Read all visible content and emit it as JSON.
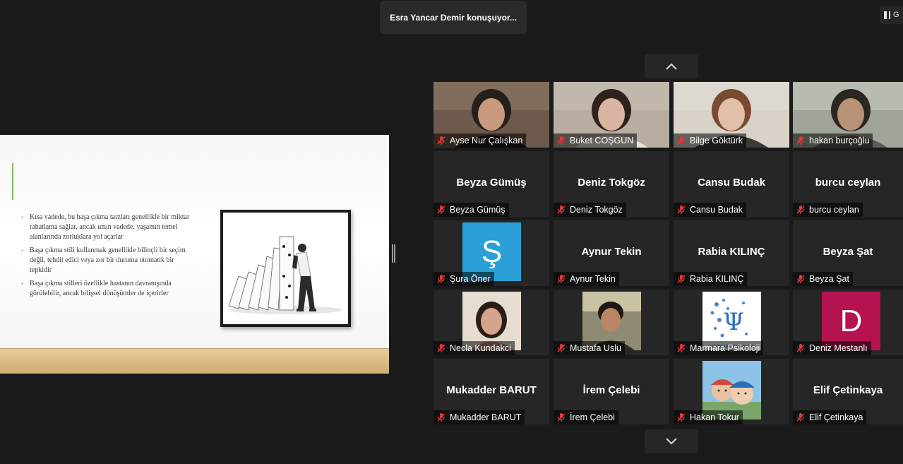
{
  "speaker_banner": {
    "text": "Esra Yancar Demir konuşuyor..."
  },
  "view_button": {
    "label": "G"
  },
  "presentation": {
    "bullets": [
      "Kısa vadede, bu başa çıkma tarzları genellikle bir miktar rahatlama sağlar, ancak uzun vadede, yaşamın temel alanlarında zorluklara yol açarlar",
      "Başa çıkma stili kullanmak genellikle bilinçli bir seçim değil, tehdit edici veya zor bir duruma otomatik bir tepkidir",
      "Başa çıkma stilleri özellikle hastanın davranışında görülebilir, ancak bilişsel dönüşümler de içerirler"
    ]
  },
  "participants": [
    {
      "name": "Ayse Nur Çalışkan",
      "video": true,
      "muted": true
    },
    {
      "name": "Buket COŞGUN",
      "video": true,
      "muted": true
    },
    {
      "name": "Bilge Göktürk",
      "video": true,
      "muted": true
    },
    {
      "name": "hakan burçoğlu",
      "video": true,
      "muted": true
    },
    {
      "name": "Beyza Gümüş",
      "video": false,
      "muted": true
    },
    {
      "name": "Deniz Tokgöz",
      "video": false,
      "muted": true
    },
    {
      "name": "Cansu Budak",
      "video": false,
      "muted": true
    },
    {
      "name": "burcu ceylan",
      "video": false,
      "muted": true
    },
    {
      "name": "Şura Öner",
      "video": false,
      "avatar_letter": "Ş",
      "avatar_color": "#2a9fd8",
      "muted": true
    },
    {
      "name": "Aynur Tekin",
      "video": false,
      "muted": true
    },
    {
      "name": "Rabia KILINÇ",
      "video": false,
      "muted": true
    },
    {
      "name": "Beyza Şat",
      "video": false,
      "muted": true
    },
    {
      "name": "Necla Kundakci",
      "video": false,
      "avatar_photo": true,
      "muted": true
    },
    {
      "name": "Mustafa Uslu",
      "video": false,
      "avatar_photo": true,
      "muted": true
    },
    {
      "name": "Marmara Psikoloji",
      "video": false,
      "avatar_photo": true,
      "muted": true
    },
    {
      "name": "Deniz Mestanlı",
      "video": false,
      "avatar_letter": "D",
      "avatar_color": "#b5124f",
      "muted": true
    },
    {
      "name": "Mukadder BARUT",
      "video": false,
      "muted": true
    },
    {
      "name": "İrem Çelebi",
      "video": false,
      "muted": true
    },
    {
      "name": "Hakan Tokur",
      "video": false,
      "avatar_photo": true,
      "muted": true
    },
    {
      "name": "Elif Çetinkaya",
      "video": false,
      "muted": true
    }
  ],
  "colors": {
    "mute_red": "#e0373a",
    "tile_bg": "#262626",
    "background": "#1a1a1a"
  }
}
